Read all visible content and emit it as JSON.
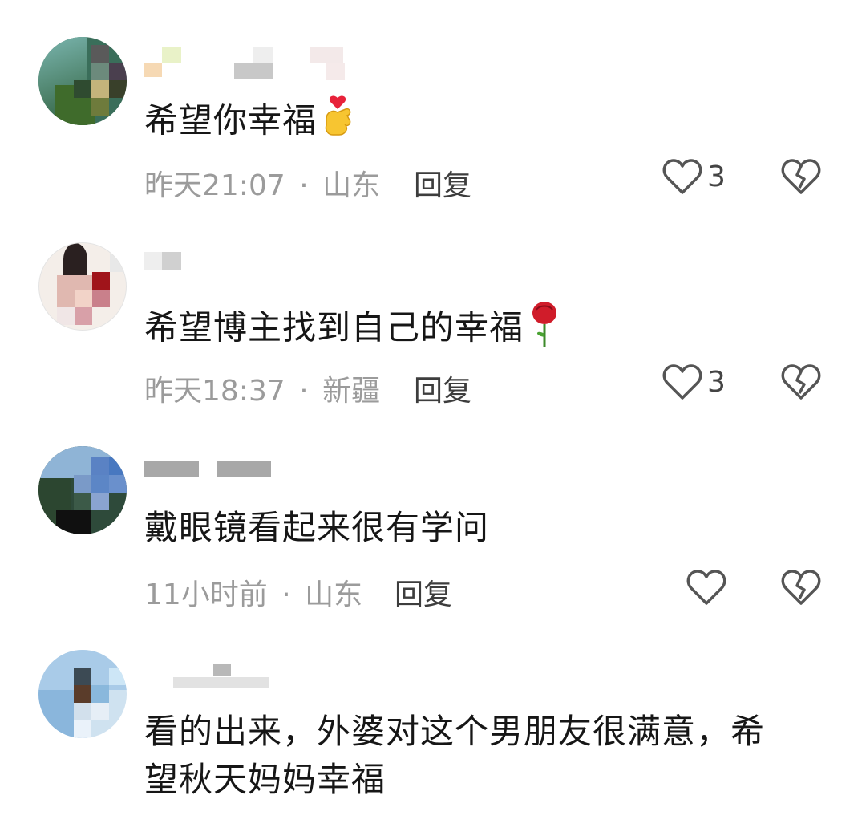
{
  "comments": [
    {
      "text": "希望你幸福",
      "emoji": "finger-heart-icon",
      "time": "昨天21:07",
      "separator": "·",
      "location": "山东",
      "reply_label": "回复",
      "like_count": "3"
    },
    {
      "text": "希望博主找到自己的幸福",
      "emoji": "rose-icon",
      "time": "昨天18:37",
      "separator": "·",
      "location": "新疆",
      "reply_label": "回复",
      "like_count": "3"
    },
    {
      "text": "戴眼镜看起来很有学问",
      "time": "11小时前",
      "separator": "·",
      "location": "山东",
      "reply_label": "回复",
      "like_count": ""
    },
    {
      "text_line1": "看的出来，外婆对这个男朋友很满意，希",
      "text_line2": "望秋天妈妈幸福"
    }
  ],
  "colors": {
    "text": "#161616",
    "meta": "#9b9b9b",
    "icon": "#555555"
  }
}
